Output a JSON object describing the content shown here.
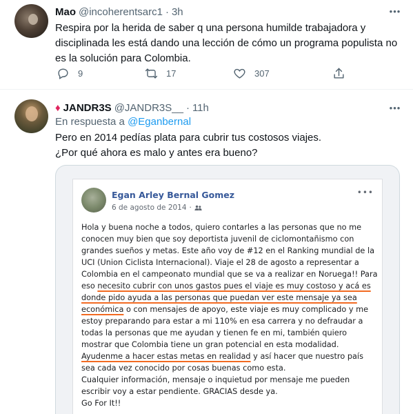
{
  "tweets": [
    {
      "name": "Mao",
      "handle": "@incoherentsarc1",
      "separator": "·",
      "time": "3h",
      "text": "Respira por la herida de saber q una persona humilde trabajadora y disciplinada les está dando una lección de cómo un programa populista no es la solución para Colombia.",
      "replies": "9",
      "retweets": "17",
      "likes": "307"
    },
    {
      "name": "JANDR3S",
      "handle": "@JANDR3S__",
      "separator": "·",
      "time": "11h",
      "reply_prefix": "En respuesta a",
      "reply_handle": "@Eganbernal",
      "text_line1": "Pero en 2014 pedías plata para cubrir tus costosos viajes.",
      "text_line2": "¿Por qué ahora es malo y antes era bueno?"
    }
  ],
  "fb_post": {
    "author": "Egan Arley Bernal Gomez",
    "date": "6 de agosto de 2014",
    "separator": "·",
    "more": "•••",
    "body_1": "Hola y buena noche a todos, quiero contarles a las personas que no me conocen muy bien que soy deportista juvenil de ciclomontañismo con grandes sueños y metas. Este año voy de #12 en el Ranking mundial de la UCI (Union Ciclista Internacional). Viaje el 28 de agosto a representar a Colombia en el campeonato mundial que se va a realizar en Noruega!! Para eso ",
    "underline_1": "necesito cubrir con unos gastos pues el viaje es muy costoso y acá es donde pido ayuda a las personas que puedan ver este mensaje ya sea económica",
    "body_2": " o con mensajes de apoyo, este viaje es muy complicado y me estoy preparando para estar a mi 110% en esa carrera y no defraudar a todas la personas que me ayudan y tienen fe en mi, también quiero mostrar que Colombia tiene un gran potencial en esta modalidad. ",
    "underline_2": "Ayudenme a hacer estas metas en realidad",
    "body_3": " y así hacer que nuestro país sea cada vez conocido por cosas buenas como esta.",
    "body_4": "Cualquier información, mensaje o inquietud por mensaje me pueden escribir voy a estar pendiente. GRACIAS desde ya.",
    "body_5": "Go For It!!"
  },
  "icons": {
    "more": "more-horizontal-icon",
    "reply": "reply-icon",
    "retweet": "retweet-icon",
    "like": "heart-icon",
    "share": "share-icon",
    "diamond": "red-diamond-emoji",
    "friends": "friends-audience-icon"
  },
  "colors": {
    "link": "#1d9bf0",
    "secondary_text": "#536471",
    "fb_name": "#365899",
    "underline": "#f26a21",
    "diamond": "#e0245e"
  }
}
